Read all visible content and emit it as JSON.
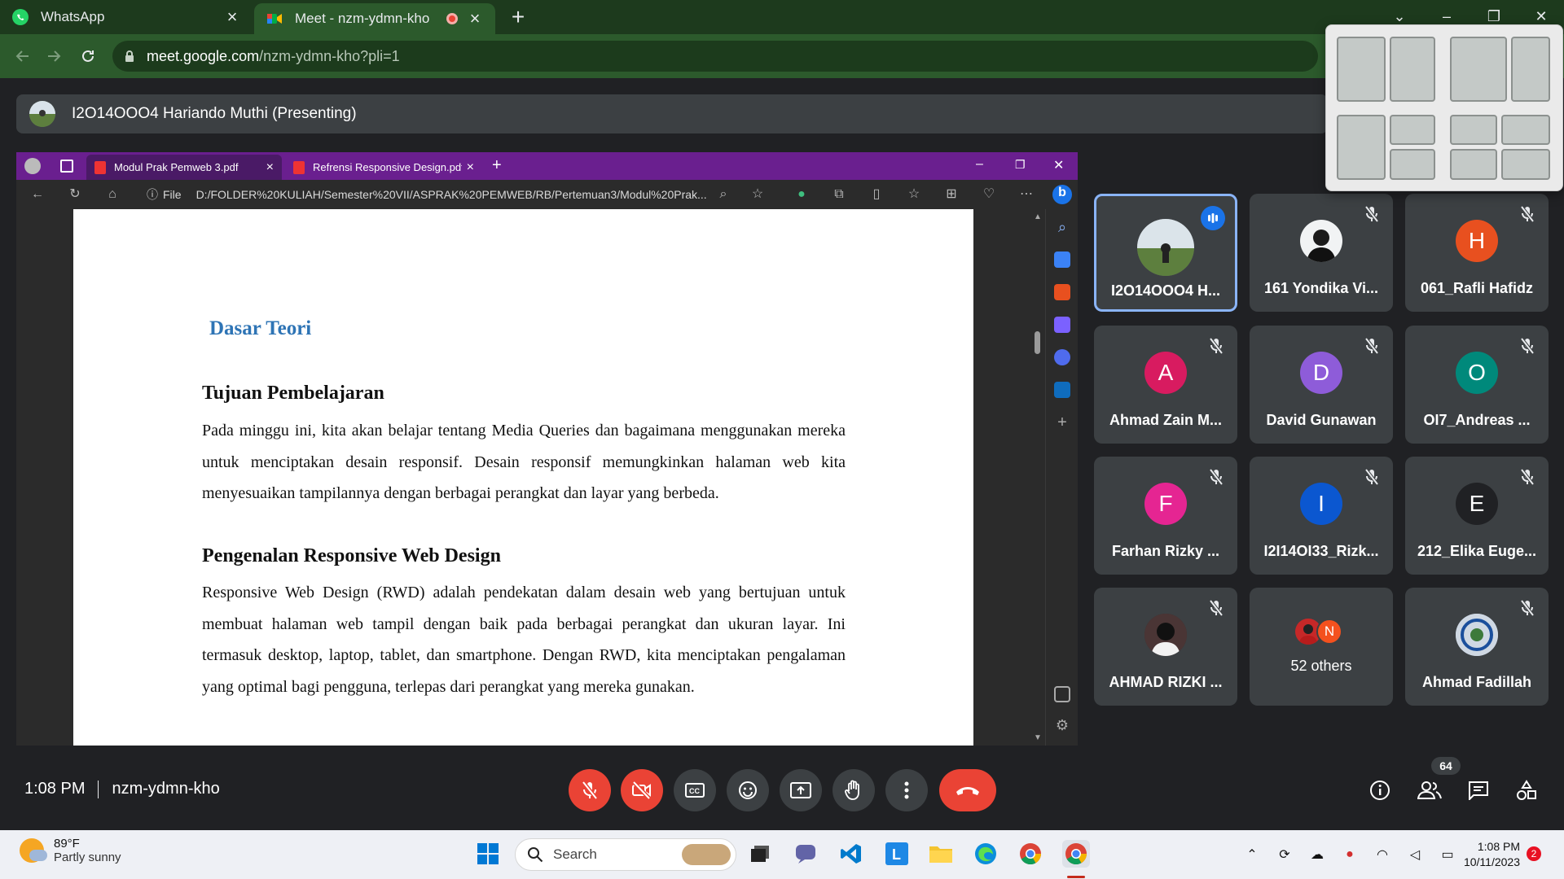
{
  "browser": {
    "tabs": [
      {
        "title": "WhatsApp",
        "icon": "whatsapp-icon"
      },
      {
        "title": "Meet - nzm-ydmn-kho",
        "icon": "google-meet-icon",
        "recording": true
      }
    ],
    "url_domain": "meet.google.com",
    "url_path": "/nzm-ydmn-kho?pli=1"
  },
  "meet": {
    "presenting_label": "I2O14OOO4 Hariando Muthi (Presenting)",
    "meeting_code": "nzm-ydmn-kho",
    "time": "1:08 PM",
    "participants_count": "64",
    "tiles": [
      {
        "name": "I2O14OOO4 H...",
        "initial": "",
        "color": "#5f6368",
        "speaking": true
      },
      {
        "name": "161 Yondika Vi...",
        "initial": "",
        "color": "#e8eaed",
        "muted": true
      },
      {
        "name": "061_Rafli Hafidz",
        "initial": "H",
        "color": "#e8501f",
        "muted": true
      },
      {
        "name": "Ahmad Zain M...",
        "initial": "A",
        "color": "#d81b60",
        "muted": true
      },
      {
        "name": "David Gunawan",
        "initial": "D",
        "color": "#8e5cd9",
        "muted": true
      },
      {
        "name": "OI7_Andreas ...",
        "initial": "O",
        "color": "#00897b",
        "muted": true
      },
      {
        "name": "Farhan Rizky ...",
        "initial": "F",
        "color": "#e52592",
        "muted": true
      },
      {
        "name": "I2I14OI33_Rizk...",
        "initial": "I",
        "color": "#0b57d0",
        "muted": true
      },
      {
        "name": "212_Elika Euge...",
        "initial": "E",
        "color": "#202124",
        "muted": true
      },
      {
        "name": "AHMAD RIZKI ...",
        "initial": "",
        "color": "#3a2a2a",
        "muted": true
      },
      {
        "name": "52 others",
        "initial": "",
        "color": "",
        "others": true
      },
      {
        "name": "Ahmad Fadillah",
        "initial": "",
        "color": "#b7c6d8",
        "muted": true
      }
    ],
    "others_initial": "N"
  },
  "shared_screen": {
    "tabs": [
      {
        "title": "Modul Prak Pemweb 3.pdf"
      },
      {
        "title": "Refrensi Responsive Design.pdf"
      }
    ],
    "file_label": "File",
    "url": "D:/FOLDER%20KULIAH/Semester%20VII/ASPRAK%20PEMWEB/RB/Pertemuan3/Modul%20Prak...",
    "pdf": {
      "section_title": "Dasar Teori",
      "h1": "Tujuan Pembelajaran",
      "p1": "Pada minggu ini, kita akan belajar tentang Media Queries dan bagaimana menggunakan mereka untuk menciptakan desain responsif. Desain responsif memungkinkan halaman web kita menyesuaikan tampilannya dengan berbagai perangkat dan layar yang berbeda.",
      "h2": "Pengenalan Responsive Web Design",
      "p2": "Responsive Web Design (RWD) adalah pendekatan dalam desain web yang bertujuan untuk membuat halaman web tampil dengan baik pada berbagai perangkat dan ukuran layar. Ini termasuk desktop, laptop, tablet, dan smartphone. Dengan RWD, kita menciptakan pengalaman yang optimal bagi pengguna, terlepas dari perangkat yang mereka gunakan."
    }
  },
  "taskbar": {
    "weather_temp": "89°F",
    "weather_desc": "Partly sunny",
    "search_placeholder": "Search",
    "clock_time": "1:08 PM",
    "clock_date": "10/11/2023",
    "notification_count": "2"
  },
  "colors": {
    "chrome_dark": "#1d3a1d",
    "chrome_mid": "#2c5a2c",
    "meet_bg": "#202124",
    "tile_bg": "#3c4043",
    "danger": "#ea4335",
    "edge_tabs": "#6a1f8f",
    "accent": "#8ab4f8"
  }
}
